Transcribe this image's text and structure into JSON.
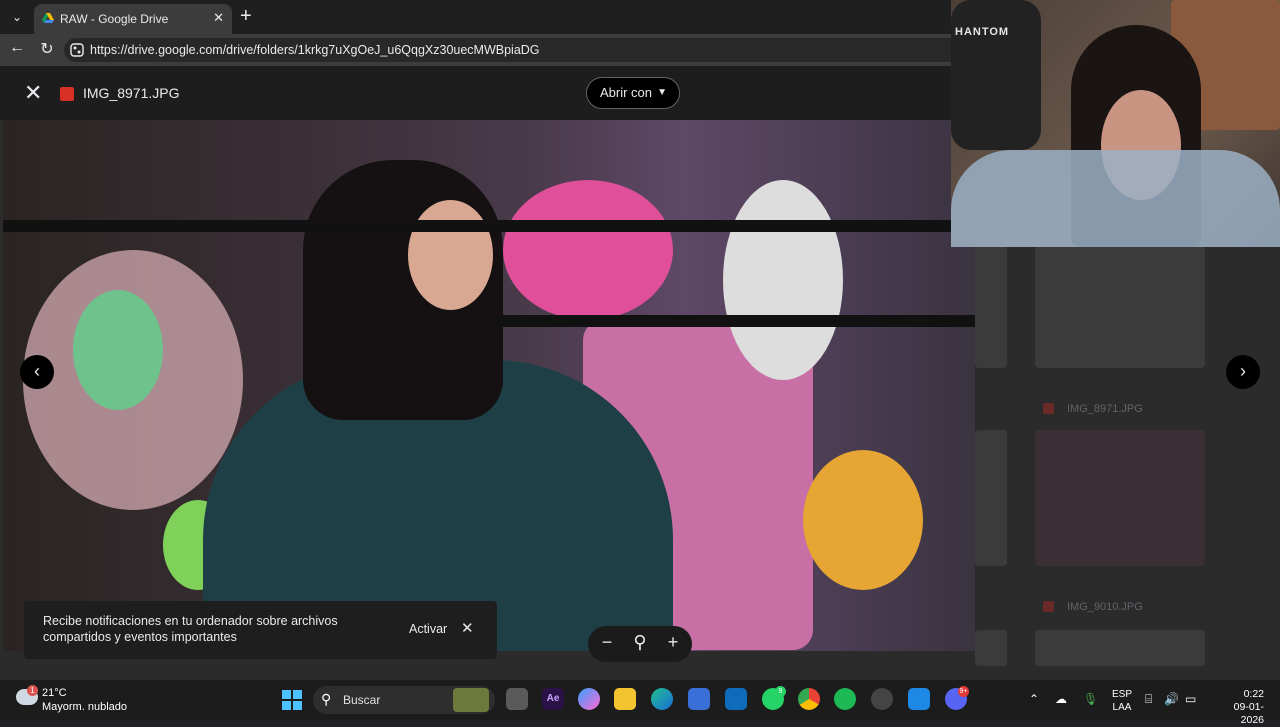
{
  "browser": {
    "tab_title": "RAW - Google Drive",
    "url": "https://drive.google.com/drive/folders/1krkg7uXgOeJ_u6QqgXz30uecMWBpiaDG"
  },
  "viewer": {
    "file_name": "IMG_8971.JPG",
    "open_with_label": "Abrir con",
    "background_files": [
      "IMG_8971.JPG",
      "IMG_9010.JPG"
    ]
  },
  "notification": {
    "text": "Recibe notificaciones en tu ordenador sobre archivos compartidos y eventos importantes",
    "action_label": "Activar"
  },
  "webcam": {
    "brand_text": "HANTOM"
  },
  "taskbar": {
    "weather_badge": "1",
    "temperature": "21°C",
    "condition": "Mayorm. nublado",
    "search_label": "Buscar",
    "whatsapp_badge": "9",
    "discord_badge": "9+",
    "language_line1": "ESP",
    "language_line2": "LAA",
    "time": "0:22",
    "date": "09-01-2026"
  }
}
